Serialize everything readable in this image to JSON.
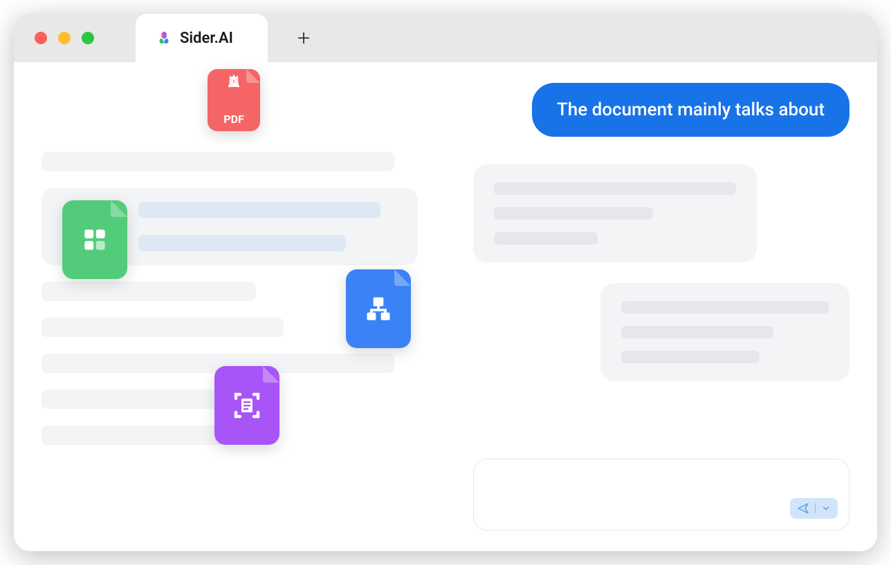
{
  "window": {
    "tab_title": "Sider.AI"
  },
  "file_icons": {
    "pdf_label": "PDF",
    "spreadsheet_name": "spreadsheet-file-icon",
    "sitemap_name": "sitemap-file-icon",
    "scan_name": "scan-document-file-icon"
  },
  "chat": {
    "user_message": "The document mainly talks about"
  },
  "icons": {
    "plus": "plus-icon",
    "send": "send-icon",
    "chevron": "chevron-down-icon"
  }
}
